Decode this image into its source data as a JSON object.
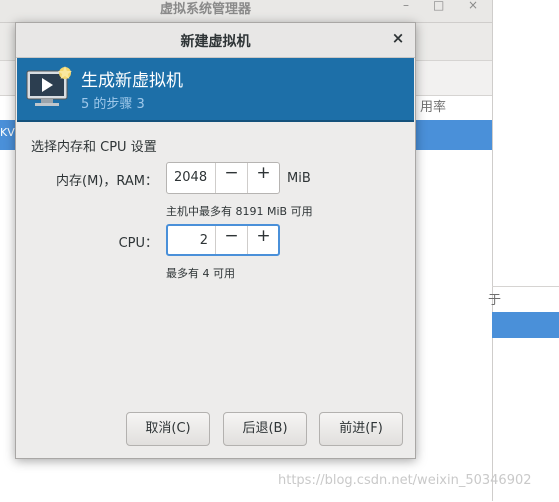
{
  "background_window": {
    "title": "虚拟系统管理器",
    "column_header": "用率",
    "selected_row_text": "KV",
    "right_panel_text": "于"
  },
  "dialog": {
    "title": "新建虚拟机",
    "close_glyph": "×",
    "banner": {
      "title": "生成新虚拟机",
      "step_text": "5 的步骤 3"
    },
    "section_title": "选择内存和 CPU 设置",
    "memory": {
      "label": "内存(M)，RAM：",
      "value": "2048",
      "unit": "MiB",
      "hint": "主机中最多有 8191 MiB 可用"
    },
    "cpu": {
      "label": "CPU：",
      "value": "2",
      "hint": "最多有 4 可用"
    },
    "buttons": {
      "cancel": "取消(C)",
      "back": "后退(B)",
      "forward": "前进(F)"
    }
  },
  "watermark": "https://blog.csdn.net/weixin_50346902",
  "colors": {
    "banner": "#1d6fa8",
    "selection": "#4a90d9"
  }
}
